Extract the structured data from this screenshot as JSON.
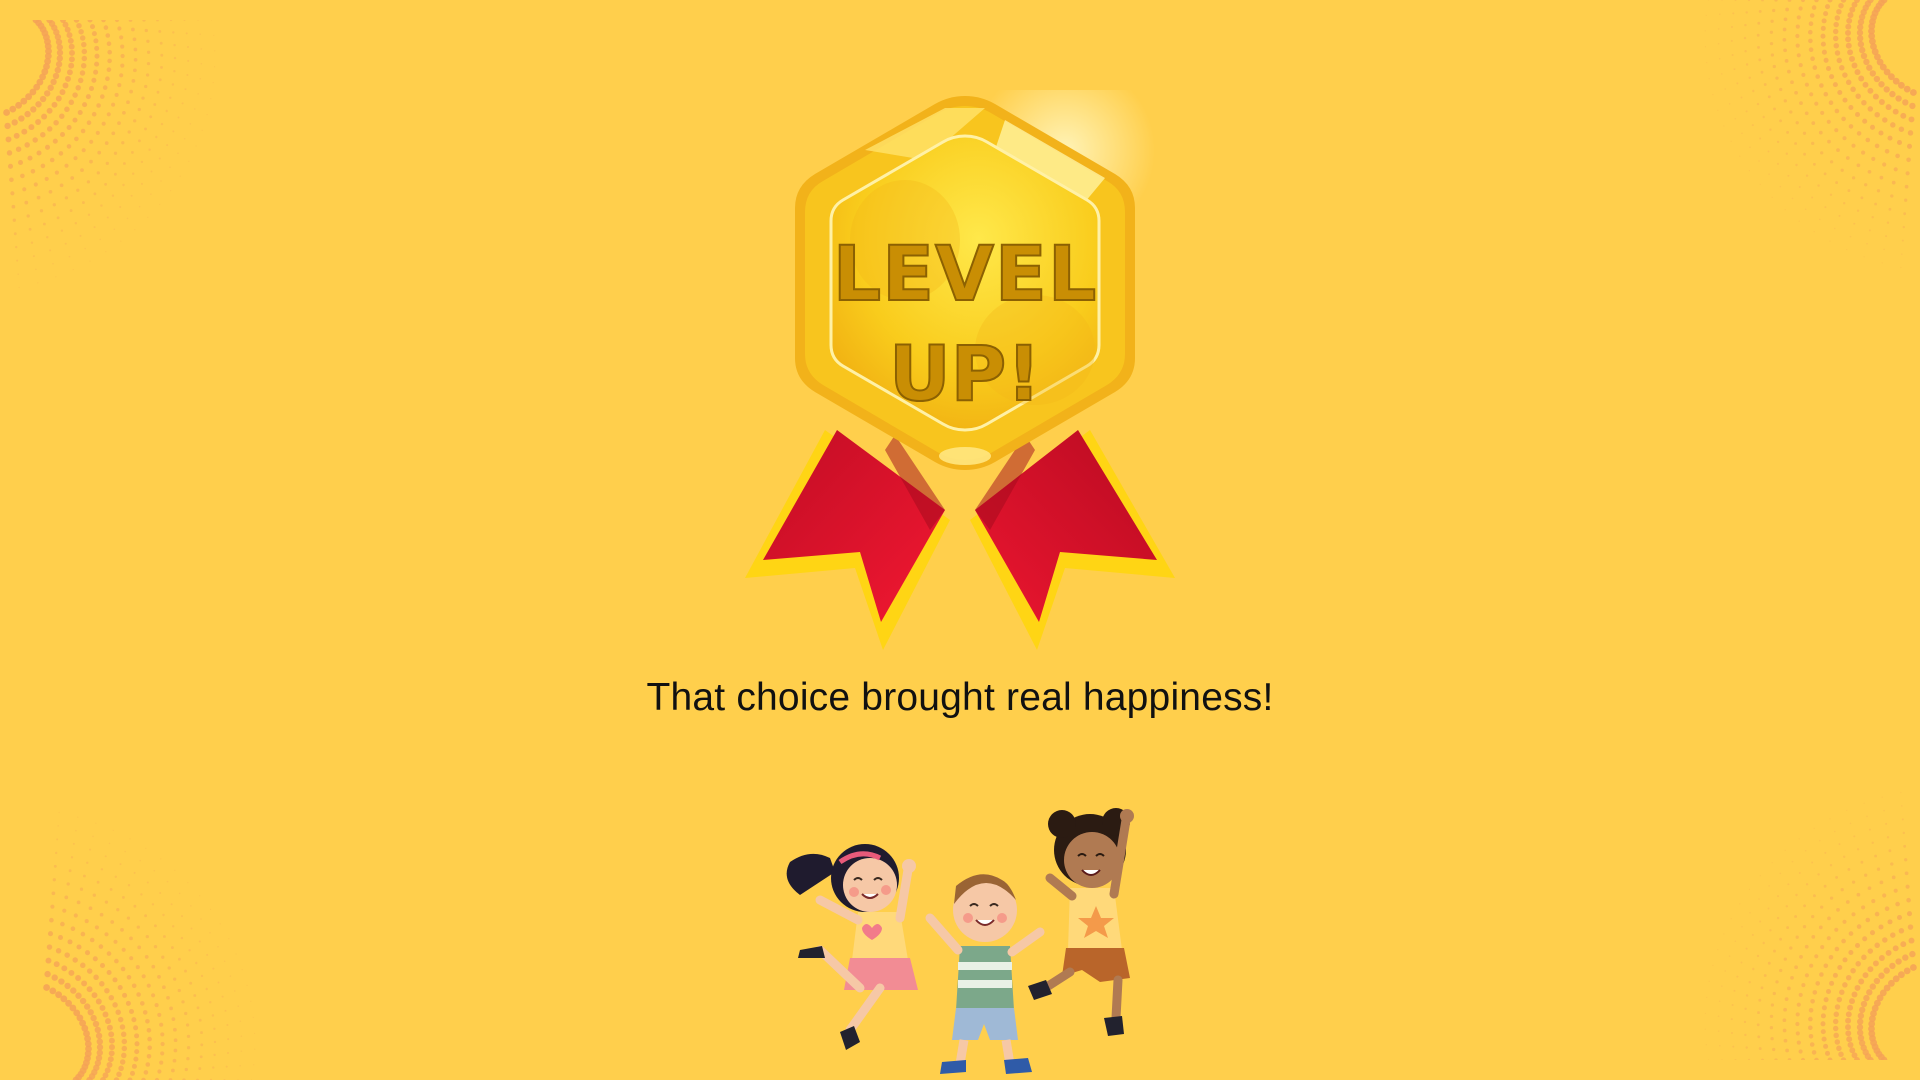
{
  "badge": {
    "line1": "LEVEL",
    "line2": "UP!"
  },
  "message": "That choice brought real happiness!",
  "illustration": "three-jumping-kids",
  "colors": {
    "background": "#ffcf4c",
    "dots": "#f5a257",
    "gold": "#f7c417",
    "gold_dark": "#e89d0b",
    "ribbon_red": "#e0102a",
    "ribbon_gold": "#ffd514",
    "badge_text": "#c98e04"
  }
}
